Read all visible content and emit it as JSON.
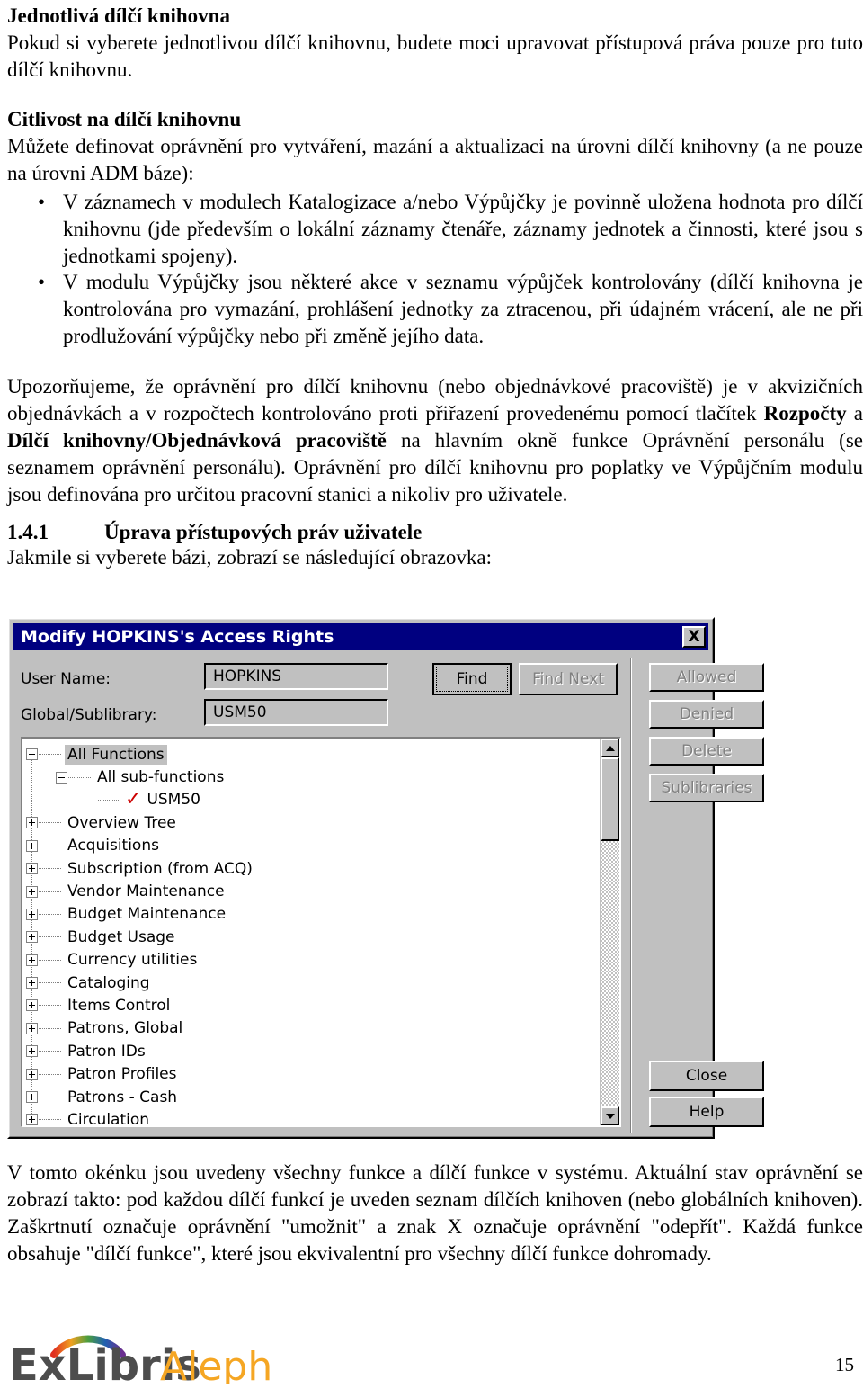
{
  "document": {
    "section_1": {
      "heading": "Jednotlivá dílčí knihovna",
      "paragraph": "Pokud si vyberete jednotlivou dílčí knihovnu, budete moci upravovat přístupová práva pouze pro tuto dílčí knihovnu."
    },
    "section_2": {
      "heading": "Citlivost na dílčí knihovnu",
      "paragraph": "Můžete definovat oprávnění pro vytváření, mazání a aktualizaci na úrovni dílčí knihovny (a ne pouze na úrovni ADM báze):",
      "bullets": [
        "V záznamech v modulech Katalogizace a/nebo Výpůjčky je povinně uložena hodnota pro dílčí knihovnu (jde především o lokální záznamy čtenáře, záznamy jednotek a činnosti, které jsou s jednotkami spojeny).",
        "V modulu Výpůjčky jsou některé akce v seznamu výpůjček kontrolovány (dílčí knihovna je kontrolována pro vymazání, prohlášení jednotky za ztracenou, při údajném vrácení, ale ne při prodlužování výpůjčky nebo při změně jejího data."
      ],
      "note_part_1": "Upozorňujeme, že oprávnění pro dílčí knihovnu (nebo objednávkové pracoviště) je v akvizičních objednávkách a v rozpočtech kontrolováno proti přiřazení provedenému pomocí tlačítek ",
      "note_bold_1": "Rozpočty",
      "note_part_2": " a ",
      "note_bold_2": "Dílčí knihovny/Objednávková pracoviště",
      "note_part_3": " na hlavním okně funkce Oprávnění personálu (se seznamem oprávnění personálu). Oprávnění pro dílčí knihovnu pro poplatky ve Výpůjčním modulu jsou definována pro určitou pracovní stanici a nikoliv pro uživatele."
    },
    "section_3": {
      "number": "1.4.1",
      "title": "Úprava přístupových práv uživatele",
      "paragraph": "Jakmile si vyberete bázi, zobrazí se následující obrazovka:"
    },
    "closing_paragraph": "V tomto okénku jsou uvedeny všechny funkce a dílčí funkce v systému. Aktuální stav oprávnění se zobrazí takto: pod každou dílčí funkcí je uveden seznam dílčích knihoven (nebo globálních knihoven). Zaškrtnutí označuje oprávnění \"umožnit\" a znak X označuje oprávnění \"odepřít\". Každá funkce obsahuje \"dílčí funkce\", které jsou ekvivalentní pro všechny dílčí funkce dohromady."
  },
  "dialog": {
    "title": "Modify HOPKINS's Access Rights",
    "close_icon_label": "X",
    "fields": [
      {
        "label": "User Name:",
        "value": "HOPKINS"
      },
      {
        "label": "Global/Sublibrary:",
        "value": "USM50"
      }
    ],
    "find_button": "Find",
    "find_next_button": "Find Next",
    "right_buttons": [
      {
        "label": "Allowed",
        "enabled": false
      },
      {
        "label": "Denied",
        "enabled": false
      },
      {
        "label": "Delete",
        "enabled": false
      },
      {
        "label": "Sublibraries",
        "enabled": false
      }
    ],
    "bottom_buttons": [
      {
        "label": "Close",
        "enabled": true
      },
      {
        "label": "Help",
        "enabled": true
      }
    ],
    "tree": [
      {
        "label": "All Functions",
        "level": 1,
        "state": "expanded",
        "selected": true,
        "check": false
      },
      {
        "label": "All sub-functions",
        "level": 2,
        "state": "expanded",
        "selected": false,
        "check": false
      },
      {
        "label": "USM50",
        "level": 3,
        "state": "leaf",
        "selected": false,
        "check": true
      },
      {
        "label": "Overview Tree",
        "level": 1,
        "state": "collapsed",
        "selected": false,
        "check": false
      },
      {
        "label": "Acquisitions",
        "level": 1,
        "state": "collapsed",
        "selected": false,
        "check": false
      },
      {
        "label": "Subscription (from ACQ)",
        "level": 1,
        "state": "collapsed",
        "selected": false,
        "check": false
      },
      {
        "label": "Vendor Maintenance",
        "level": 1,
        "state": "collapsed",
        "selected": false,
        "check": false
      },
      {
        "label": "Budget Maintenance",
        "level": 1,
        "state": "collapsed",
        "selected": false,
        "check": false
      },
      {
        "label": "Budget Usage",
        "level": 1,
        "state": "collapsed",
        "selected": false,
        "check": false
      },
      {
        "label": "Currency utilities",
        "level": 1,
        "state": "collapsed",
        "selected": false,
        "check": false
      },
      {
        "label": "Cataloging",
        "level": 1,
        "state": "collapsed",
        "selected": false,
        "check": false
      },
      {
        "label": "Items Control",
        "level": 1,
        "state": "collapsed",
        "selected": false,
        "check": false
      },
      {
        "label": "Patrons, Global",
        "level": 1,
        "state": "collapsed",
        "selected": false,
        "check": false
      },
      {
        "label": "Patron IDs",
        "level": 1,
        "state": "collapsed",
        "selected": false,
        "check": false
      },
      {
        "label": "Patron Profiles",
        "level": 1,
        "state": "collapsed",
        "selected": false,
        "check": false
      },
      {
        "label": "Patrons - Cash",
        "level": 1,
        "state": "collapsed",
        "selected": false,
        "check": false
      },
      {
        "label": "Circulation",
        "level": 1,
        "state": "collapsed",
        "selected": false,
        "check": false
      }
    ],
    "check_mark_glyph": "✓"
  },
  "footer": {
    "logo_primary": "ExLibris",
    "logo_secondary": "Aleph",
    "page_number": "15"
  },
  "colors": {
    "titlebar": "#000080",
    "dialog_face": "#c0c0c0",
    "check_red": "#cc0000",
    "logo_dark": "#4d4d4d",
    "logo_orange": "#f5a623"
  }
}
